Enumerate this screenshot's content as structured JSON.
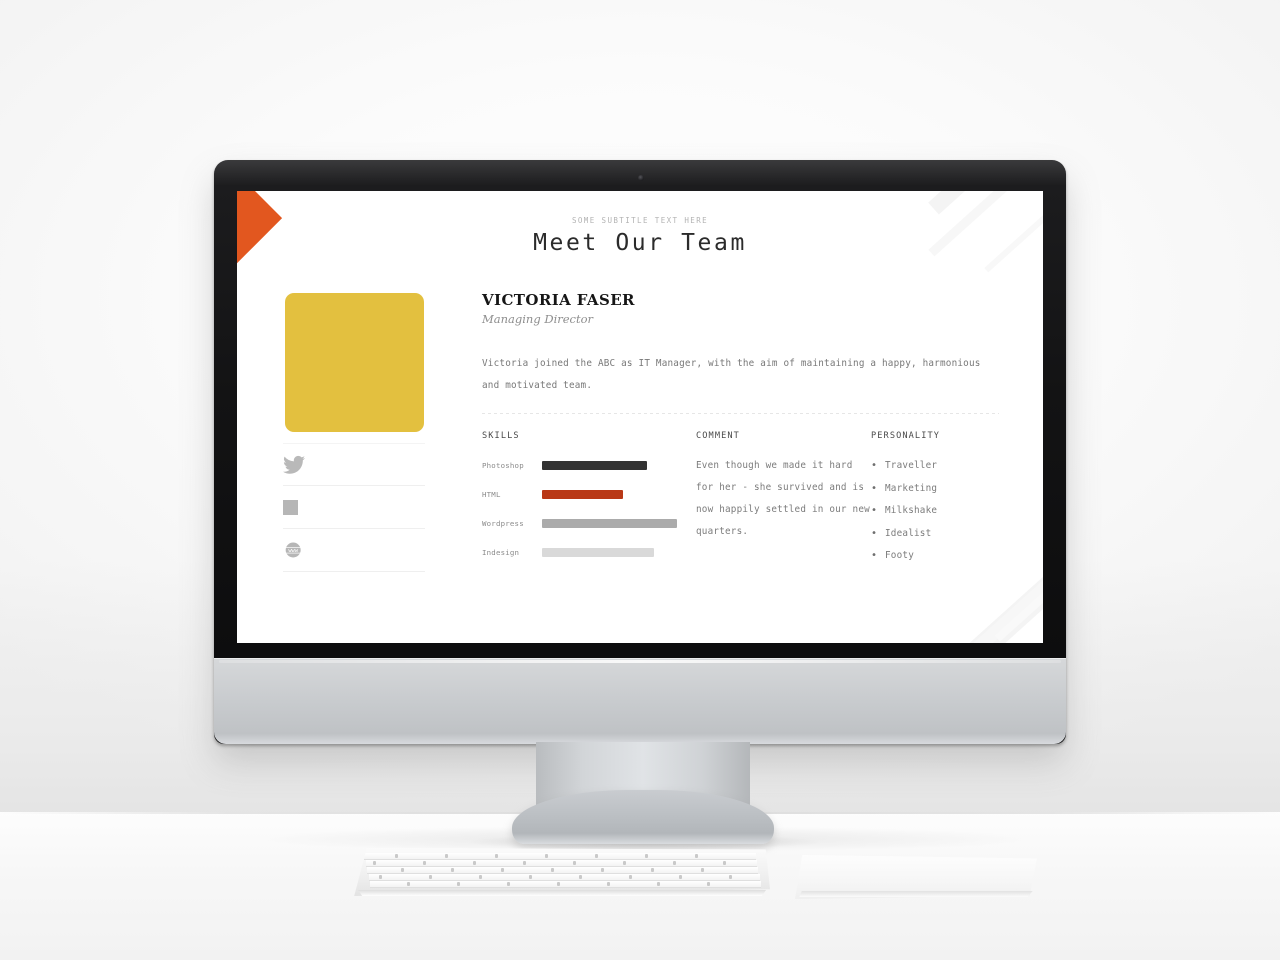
{
  "slide": {
    "subtitle": "SOME SUBTITLE TEXT HERE",
    "title": "Meet Our Team",
    "person": {
      "name": "VICTORIA FASER",
      "role": "Managing Director",
      "bio": "Victoria joined the ABC as IT Manager, with the aim of maintaining a happy, harmonious and motivated team."
    },
    "social": [
      {
        "icon": "twitter-icon",
        "label": "Twitter"
      },
      {
        "icon": "square-icon",
        "label": "Square"
      },
      {
        "icon": "www-globe-icon",
        "label": "Website"
      }
    ],
    "skills": {
      "heading": "SKILLS",
      "items": [
        {
          "label": "Photoshop",
          "percent": 78,
          "color": "#333333"
        },
        {
          "label": "HTML",
          "percent": 60,
          "color": "#b93816"
        },
        {
          "label": "Wordpress",
          "percent": 100,
          "color": "#ababab"
        },
        {
          "label": "Indesign",
          "percent": 83,
          "color": "#d9d9d9"
        }
      ]
    },
    "comment": {
      "heading": "COMMENT",
      "text": "Even though we made it hard for her - she survived and is now happily settled in our new quarters."
    },
    "personality": {
      "heading": "PERSONALITY",
      "items": [
        "Traveller",
        "Marketing",
        "Milkshake",
        "Idealist",
        "Footy"
      ]
    },
    "accent_colors": {
      "orange": "#e2571f",
      "yellow": "#e3c03f",
      "red": "#b93816",
      "gray": "#a9a9a9"
    }
  }
}
